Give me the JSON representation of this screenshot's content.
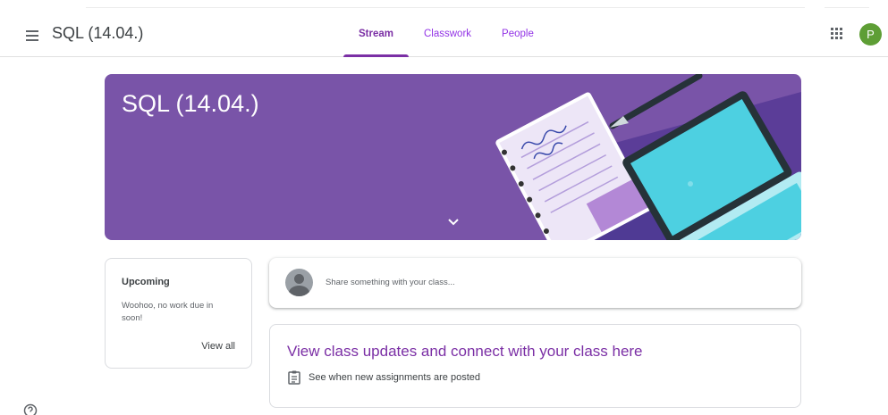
{
  "colors": {
    "accent": "#7b2fa5",
    "banner_bg": "#7954a8",
    "avatar_bg": "#5e9e35"
  },
  "header": {
    "class_title": "SQL (14.04.)",
    "tabs": [
      {
        "label": "Stream",
        "active": true
      },
      {
        "label": "Classwork",
        "active": false
      },
      {
        "label": "People",
        "active": false
      }
    ],
    "avatar_letter": "P"
  },
  "banner": {
    "title": "SQL (14.04.)"
  },
  "upcoming": {
    "title": "Upcoming",
    "empty_text": "Woohoo, no work due in soon!",
    "view_all": "View all"
  },
  "share": {
    "placeholder": "Share something with your class..."
  },
  "updates": {
    "title": "View class updates and connect with your class here",
    "item": "See when new assignments are posted"
  },
  "icons": {
    "menu": "hamburger-menu-icon",
    "apps": "google-apps-icon",
    "expand": "chevron-down-icon",
    "assignment": "assignment-icon",
    "help": "help-icon"
  }
}
